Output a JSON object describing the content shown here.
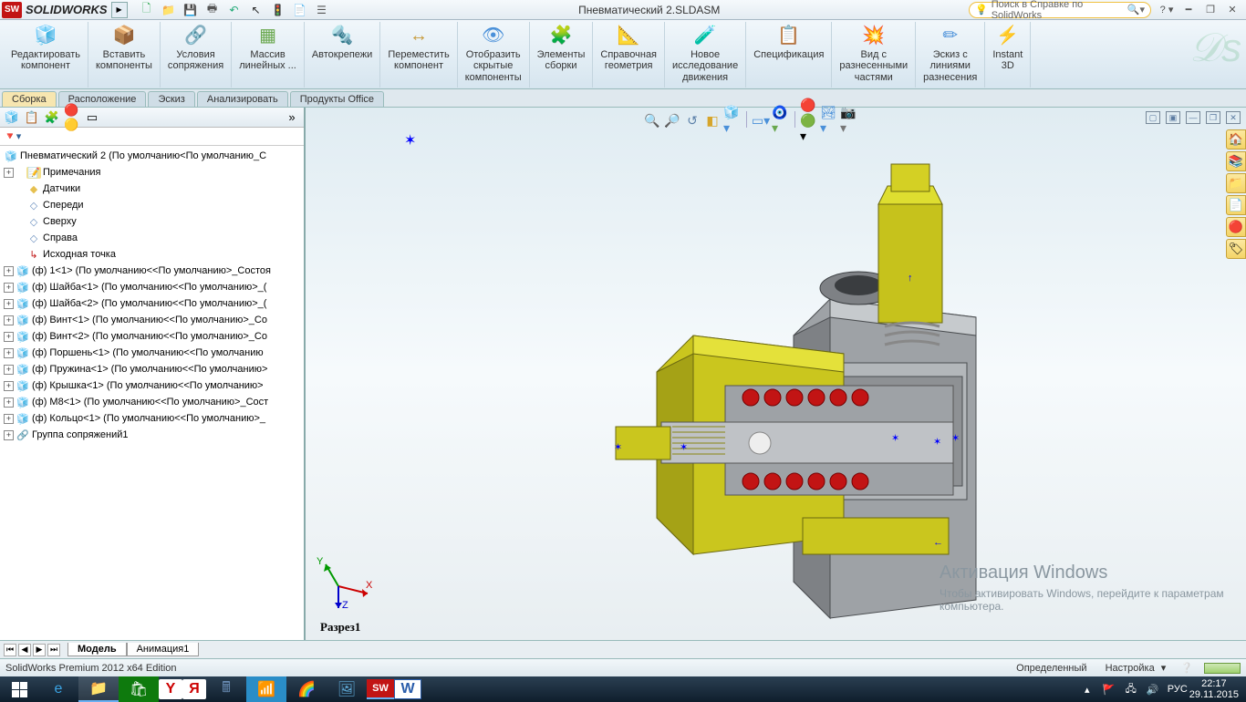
{
  "app": {
    "brand_short": "SW",
    "brand": "SOLIDWORKS",
    "doc_title": "Пневматический  2.SLDASM"
  },
  "search": {
    "placeholder": "Поиск в Справке по SolidWorks"
  },
  "qat": {
    "newdoc": "🗋",
    "open": "📁",
    "save": "💾",
    "print": "🖶",
    "undo": "↶",
    "select": "↖",
    "rebuild": "🚦",
    "options": "📄",
    "props": "☰"
  },
  "ribbon": {
    "items": [
      {
        "icon": "🧊",
        "label": "Редактировать\nкомпонент",
        "color": "#c7955a"
      },
      {
        "icon": "📦",
        "label": "Вставить\nкомпоненты",
        "color": "#d6b34a"
      },
      {
        "icon": "🔗",
        "label": "Условия\nсопряжения",
        "color": "#6aa84f"
      },
      {
        "icon": "▦",
        "label": "Массив\nлинейных ...",
        "color": "#6aa84f"
      },
      {
        "icon": "🔩",
        "label": "Автокрепежи",
        "color": "#c79a3a"
      },
      {
        "icon": "↔",
        "label": "Переместить\nкомпонент",
        "color": "#c79a3a"
      },
      {
        "icon": "👁",
        "label": "Отобразить\nскрытые\nкомпоненты",
        "color": "#4a90d9"
      },
      {
        "icon": "🧩",
        "label": "Элементы\nсборки",
        "color": "#4a90d9"
      },
      {
        "icon": "📐",
        "label": "Справочная\nгеометрия",
        "color": "#c79a3a"
      },
      {
        "icon": "🧪",
        "label": "Новое\nисследование\nдвижения",
        "color": "#c79a3a"
      },
      {
        "icon": "📋",
        "label": "Спецификация",
        "color": "#c79a3a"
      },
      {
        "icon": "💥",
        "label": "Вид с\nразнесенными\nчастями",
        "color": "#c79a3a"
      },
      {
        "icon": "✏",
        "label": "Эскиз с\nлиниями\nразнесения",
        "color": "#4a90d9"
      },
      {
        "icon": "⚡",
        "label": "Instant\n3D",
        "color": "#4a90d9"
      }
    ]
  },
  "cm_tabs": [
    "Сборка",
    "Расположение",
    "Эскиз",
    "Анализировать",
    "Продукты Office"
  ],
  "fm": {
    "root": "Пневматический  2  (По умолчанию<По умолчанию_С",
    "nodes": [
      {
        "exp": "+",
        "ico": "📝",
        "txt": "Примечания",
        "ind": 1,
        "icoColor": "#e6c050",
        "bg": "#f5e08a"
      },
      {
        "exp": "",
        "ico": "◆",
        "txt": "Датчики",
        "ind": 1,
        "icoColor": "#e6c050"
      },
      {
        "exp": "",
        "ico": "◇",
        "txt": "Спереди",
        "ind": 1,
        "icoColor": "#6a8fbf"
      },
      {
        "exp": "",
        "ico": "◇",
        "txt": "Сверху",
        "ind": 1,
        "icoColor": "#6a8fbf"
      },
      {
        "exp": "",
        "ico": "◇",
        "txt": "Справа",
        "ind": 1,
        "icoColor": "#6a8fbf"
      },
      {
        "exp": "",
        "ico": "↳",
        "txt": "Исходная точка",
        "ind": 1,
        "icoColor": "#c01818"
      },
      {
        "exp": "+",
        "ico": "🧊",
        "txt": "(ф) 1<1> (По умолчанию<<По умолчанию>_Состоя",
        "ind": 0,
        "icoColor": "#d6b34a"
      },
      {
        "exp": "+",
        "ico": "🧊",
        "txt": "(ф) Шайба<1> (По умолчанию<<По умолчанию>_(",
        "ind": 0,
        "icoColor": "#d6b34a"
      },
      {
        "exp": "+",
        "ico": "🧊",
        "txt": "(ф) Шайба<2> (По умолчанию<<По умолчанию>_(",
        "ind": 0,
        "icoColor": "#d6b34a"
      },
      {
        "exp": "+",
        "ico": "🧊",
        "txt": "(ф) Винт<1> (По умолчанию<<По умолчанию>_Со",
        "ind": 0,
        "icoColor": "#d6b34a"
      },
      {
        "exp": "+",
        "ico": "🧊",
        "txt": "(ф) Винт<2> (По умолчанию<<По умолчанию>_Со",
        "ind": 0,
        "icoColor": "#d6b34a"
      },
      {
        "exp": "+",
        "ico": "🧊",
        "txt": "(ф) Поршень<1> (По умолчанию<<По умолчанию",
        "ind": 0,
        "icoColor": "#d6b34a"
      },
      {
        "exp": "+",
        "ico": "🧊",
        "txt": "(ф) Пружина<1> (По умолчанию<<По умолчанию>",
        "ind": 0,
        "icoColor": "#d6b34a"
      },
      {
        "exp": "+",
        "ico": "🧊",
        "txt": "(ф) Крышка<1> (По умолчанию<<По умолчанию>",
        "ind": 0,
        "icoColor": "#d6b34a"
      },
      {
        "exp": "+",
        "ico": "🧊",
        "txt": "(ф) М8<1> (По умолчанию<<По умолчанию>_Сост",
        "ind": 0,
        "icoColor": "#d6b34a"
      },
      {
        "exp": "+",
        "ico": "🧊",
        "txt": "(ф) Кольцо<1> (По умолчанию<<По умолчанию>_",
        "ind": 0,
        "icoColor": "#d6b34a"
      },
      {
        "exp": "+",
        "ico": "🔗",
        "txt": "Группа сопряжений1",
        "ind": 0,
        "icoColor": "#888"
      }
    ]
  },
  "viewport": {
    "view_name": "Разрез1",
    "watermark_title": "Активация Windows",
    "watermark_text": "Чтобы активировать Windows, перейдите к параметрам компьютера.",
    "triad": {
      "x": "X",
      "y": "Y",
      "z": "Z"
    }
  },
  "bottom_tabs": [
    "Модель",
    "Анимация1"
  ],
  "status": {
    "left": "SolidWorks Premium 2012 x64 Edition",
    "state": "Определенный",
    "custom": "Настройка"
  },
  "tray": {
    "lang": "РУС",
    "time": "22:17",
    "date": "29.11.2015"
  }
}
